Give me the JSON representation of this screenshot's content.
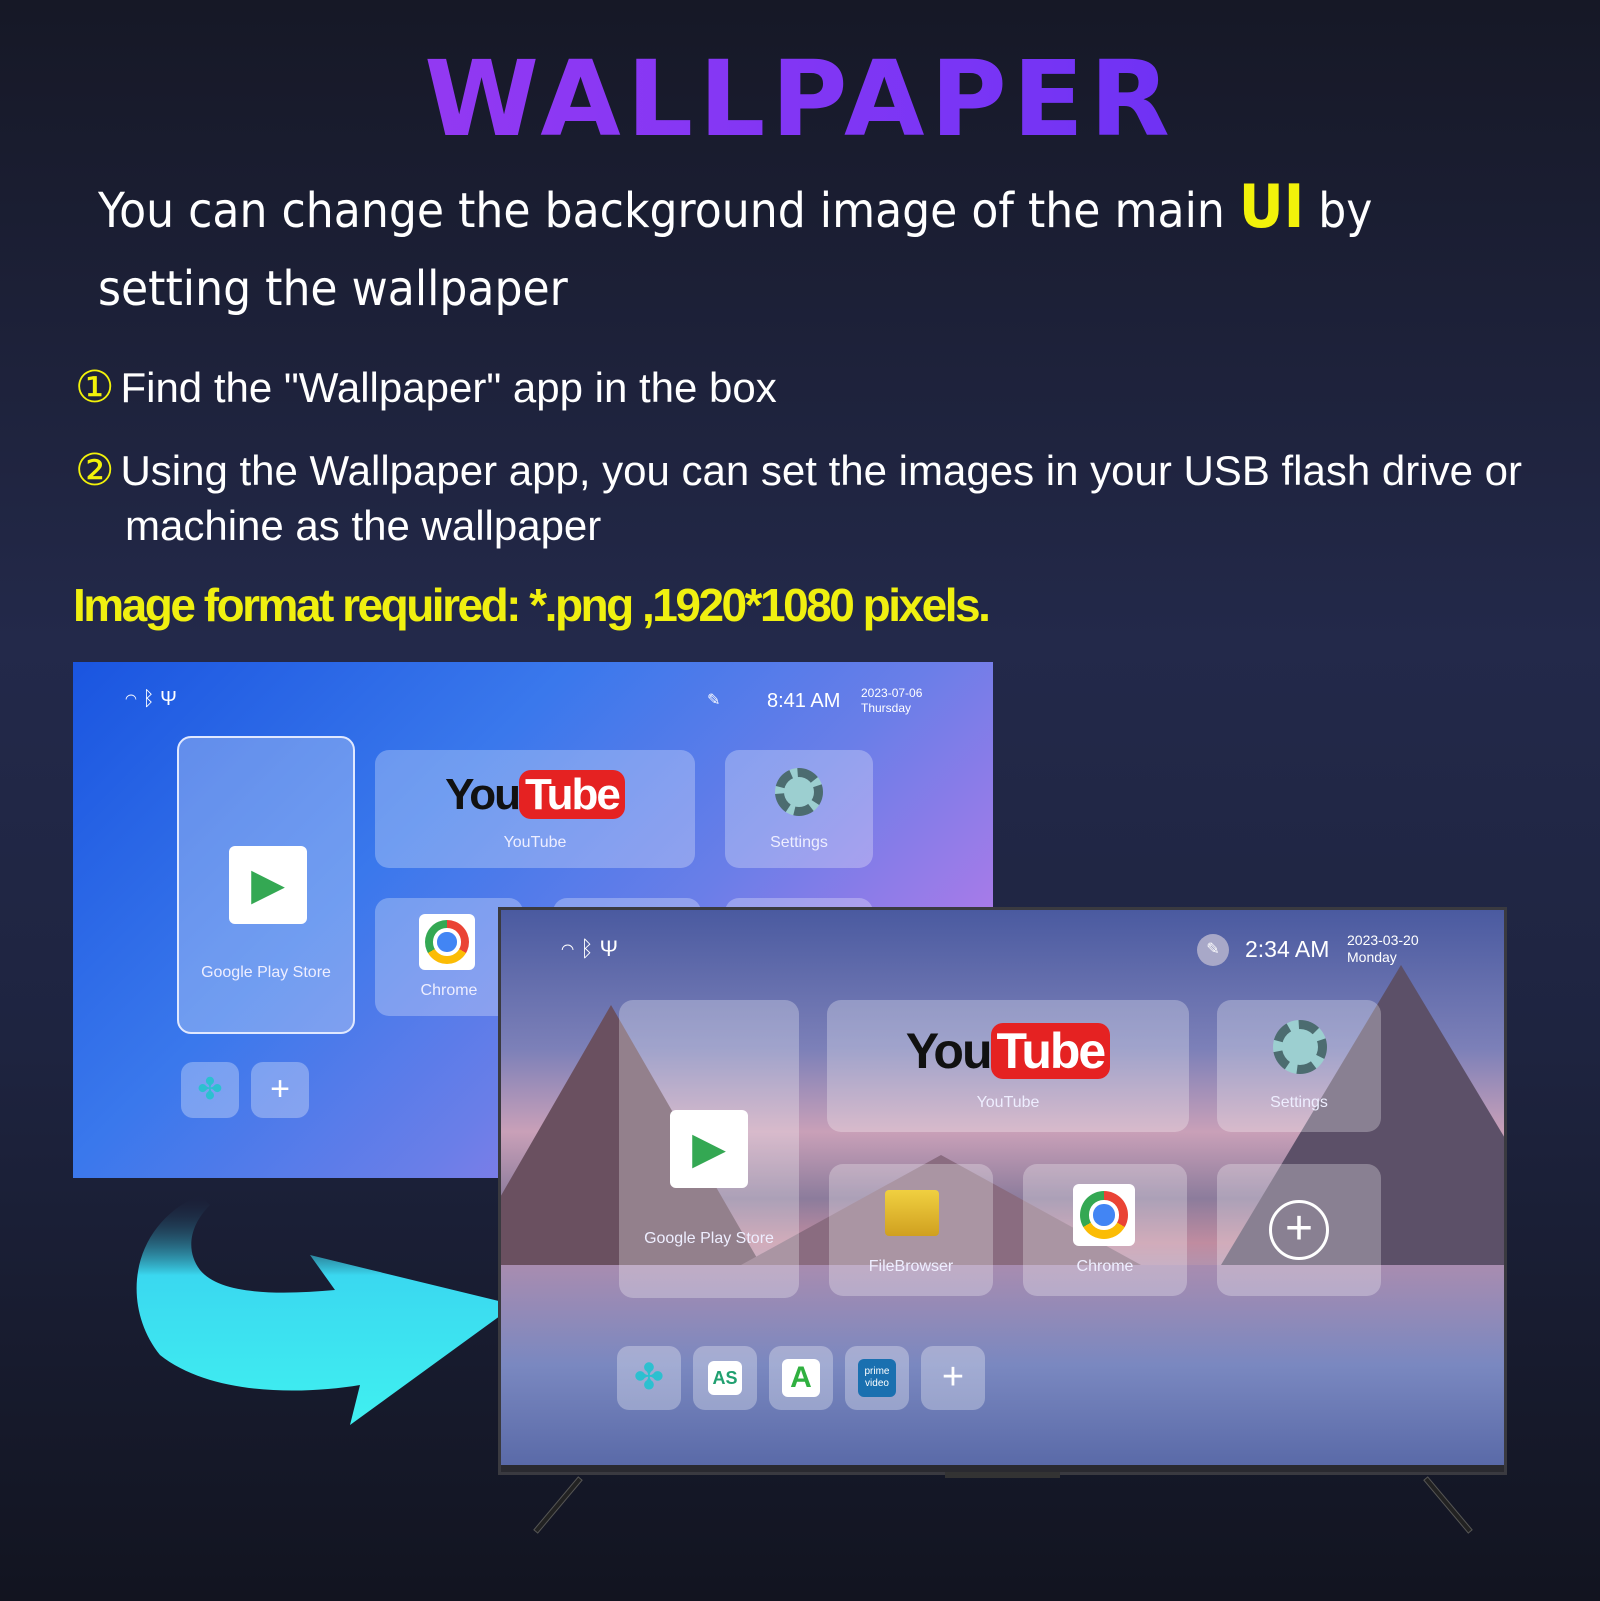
{
  "title": "WALLPAPER",
  "intro": {
    "before": "You can change the background image of the main ",
    "highlight": "UI",
    "after": " by setting the wallpaper"
  },
  "steps": [
    {
      "num": "①",
      "text": "Find the \"Wallpaper\" app in the box"
    },
    {
      "num": "②",
      "text": "Using the Wallpaper app, you can set the images in your USB flash drive or machine as the wallpaper"
    }
  ],
  "format_note": "Image format required: *.png ,1920*1080 pixels.",
  "colors": {
    "title": "#8a38f2",
    "highlight": "#f2f20a",
    "arrow": "#38e8f2"
  },
  "screen_before": {
    "time": "8:41 AM",
    "date": "2023-07-06",
    "day": "Thursday",
    "apps": {
      "play": "Google Play Store",
      "youtube": "YouTube",
      "settings": "Settings",
      "chrome": "Chrome"
    },
    "youtube_logo": {
      "you": "You",
      "tube": "Tube"
    },
    "status_icons": [
      "wifi-icon",
      "bluetooth-icon",
      "usb-icon"
    ]
  },
  "screen_after": {
    "time": "2:34 AM",
    "date": "2023-03-20",
    "day": "Monday",
    "apps": {
      "play": "Google Play Store",
      "youtube": "YouTube",
      "settings": "Settings",
      "filebrowser": "FileBrowser",
      "chrome": "Chrome"
    },
    "youtube_logo": {
      "you": "You",
      "tube": "Tube"
    },
    "dock": {
      "as": "AS",
      "prime": "prime video"
    },
    "status_icons": [
      "wifi-icon",
      "bluetooth-icon",
      "usb-icon"
    ]
  }
}
